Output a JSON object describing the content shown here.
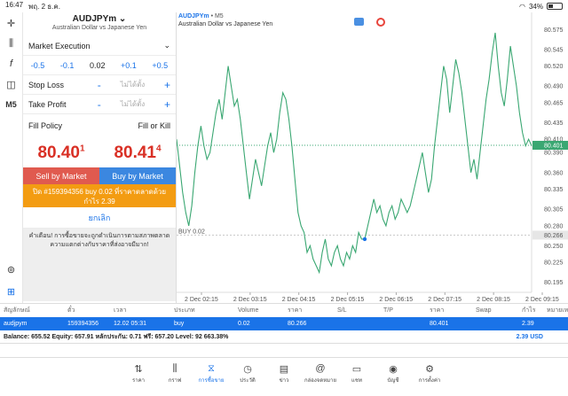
{
  "status": {
    "time": "16:47",
    "date": "พฤ. 2 ธ.ค.",
    "battery": "34%"
  },
  "toolbar_icons": [
    "crosshair-icon",
    "candles-icon",
    "function-icon",
    "shapes-icon",
    "M5"
  ],
  "order": {
    "symbol": "AUDJPYm",
    "description": "Australian Dollar vs Japanese Yen",
    "execution": "Market Execution",
    "adjust": [
      "-0.5",
      "-0.1",
      "0.02",
      "+0.1",
      "+0.5"
    ],
    "stop_loss_label": "Stop Loss",
    "take_profit_label": "Take Profit",
    "not_set": "ไม่ได้ตั้ง",
    "minus": "-",
    "plus": "+",
    "fill_policy_label": "Fill Policy",
    "fill_policy_value": "Fill or Kill",
    "bid_main": "80.40",
    "bid_sup": "1",
    "ask_main": "80.41",
    "ask_sup": "4",
    "sell_label": "Sell by Market",
    "buy_label": "Buy by Market",
    "close_text_1": "ปิด #159394356 buy 0.02 ที่ราคาตลาดด้วย",
    "close_text_2": "กำไร 2.39",
    "cancel_label": "ยกเลิก",
    "warning": "คำเตือน! การซื้อขายจะถูกดำเนินการตามสภาพตลาด ความแตกต่างกับราคาที่ส่งอาจมีมาก!"
  },
  "chart_title": {
    "symbol": "AUDJPYm",
    "timeframe": " • M5",
    "description": "Australian Dollar vs Japanese Yen"
  },
  "chart_data": {
    "type": "line",
    "x_labels": [
      "2 Dec 02:15",
      "2 Dec 03:15",
      "2 Dec 04:15",
      "2 Dec 05:15",
      "2 Dec 06:15",
      "2 Dec 07:15",
      "2 Dec 08:15",
      "2 Dec 09:15"
    ],
    "y_ticks": [
      "80.575",
      "80.545",
      "80.520",
      "80.490",
      "80.465",
      "80.435",
      "80.410",
      "80.390",
      "80.360",
      "80.335",
      "80.305",
      "80.280",
      "80.250",
      "80.225",
      "80.195"
    ],
    "y_tick_values": [
      80.575,
      80.545,
      80.52,
      80.49,
      80.465,
      80.435,
      80.41,
      80.39,
      80.36,
      80.335,
      80.305,
      80.28,
      80.25,
      80.225,
      80.195
    ],
    "ylim": [
      80.18,
      80.59
    ],
    "current_price": 80.401,
    "current_price_label": "80.401",
    "buy_level": 80.266,
    "buy_level_label": "80.266",
    "buy_line_text": "BUY 0.02",
    "entry_index": 62,
    "series": [
      80.41,
      80.37,
      80.33,
      80.3,
      80.28,
      80.31,
      80.36,
      80.4,
      80.43,
      80.4,
      80.38,
      80.39,
      80.42,
      80.45,
      80.47,
      80.44,
      80.48,
      80.52,
      80.49,
      80.46,
      80.47,
      80.44,
      80.4,
      80.36,
      80.32,
      80.35,
      80.38,
      80.36,
      80.34,
      80.37,
      80.4,
      80.42,
      80.39,
      80.41,
      80.45,
      80.48,
      80.47,
      80.44,
      80.4,
      80.35,
      80.3,
      80.28,
      80.27,
      80.24,
      80.25,
      80.23,
      80.22,
      80.21,
      80.24,
      80.26,
      80.23,
      80.22,
      80.24,
      80.25,
      80.23,
      80.22,
      80.24,
      80.23,
      80.25,
      80.24,
      80.27,
      80.26,
      80.26,
      80.28,
      80.3,
      80.32,
      80.3,
      80.31,
      80.29,
      80.28,
      80.3,
      80.31,
      80.29,
      80.3,
      80.32,
      80.31,
      80.3,
      80.31,
      80.33,
      80.35,
      80.37,
      80.39,
      80.36,
      80.33,
      80.35,
      80.4,
      80.44,
      80.48,
      80.52,
      80.5,
      80.45,
      80.49,
      80.53,
      80.51,
      80.48,
      80.44,
      80.4,
      80.36,
      80.38,
      80.35,
      80.39,
      80.43,
      80.47,
      80.5,
      80.54,
      80.57,
      80.52,
      80.48,
      80.46,
      80.5,
      80.55,
      80.52,
      80.49,
      80.45,
      80.42,
      80.4,
      80.41,
      80.4
    ]
  },
  "table": {
    "headers": [
      "สัญลักษณ์",
      "ตั๋ว",
      "เวลา",
      "ประเภท",
      "Volume",
      "ราคา",
      "S/L",
      "T/P",
      "ราคา",
      "Swap",
      "กำไร",
      "หมายเหตุ"
    ],
    "row": [
      "audjpym",
      "159394356",
      "12.02 05:31",
      "buy",
      "0.02",
      "80.266",
      "",
      "",
      "80.401",
      "",
      "2.39",
      ""
    ],
    "balance": "Balance: 655.52 Equity: 657.91 หลักประกัน: 0.71 ฟรี: 657.20 Level: 92 663.38%",
    "total_profit": "2.39  USD"
  },
  "tabs": [
    {
      "label": "ราคา",
      "icon": "quotes-icon"
    },
    {
      "label": "กราฟ",
      "icon": "chart-icon"
    },
    {
      "label": "การซื้อขาย",
      "icon": "trade-icon",
      "active": true
    },
    {
      "label": "ประวัติ",
      "icon": "history-icon"
    },
    {
      "label": "ข่าว",
      "icon": "news-icon"
    },
    {
      "label": "กล่องจดหมาย",
      "icon": "mailbox-icon"
    },
    {
      "label": "แชท",
      "icon": "chat-icon"
    },
    {
      "label": "บัญชี",
      "icon": "account-icon"
    },
    {
      "label": "การตั้งค่า",
      "icon": "settings-icon"
    }
  ]
}
